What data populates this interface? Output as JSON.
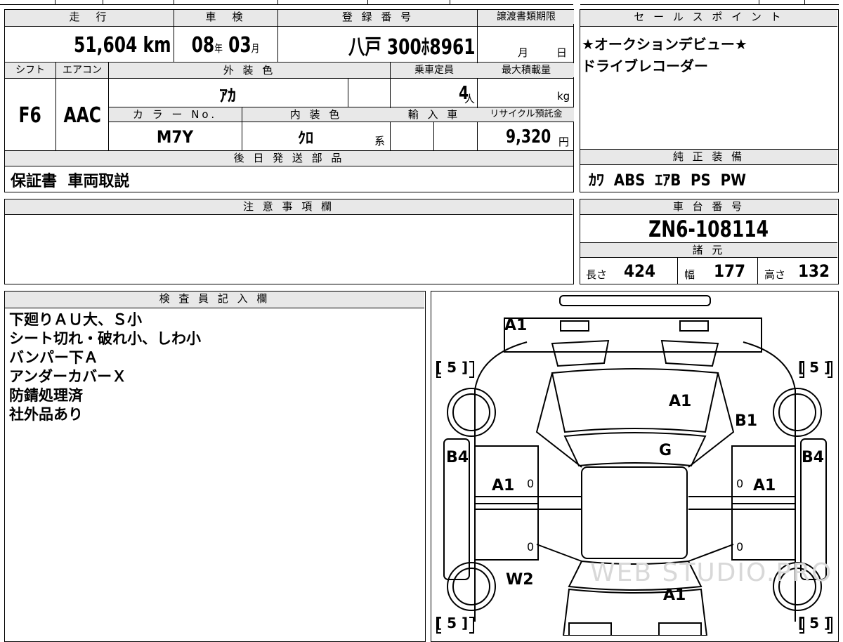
{
  "mileage": {
    "header": "走　行",
    "value": "51,604",
    "unit": "km"
  },
  "shaken": {
    "header": "車　検",
    "year": "08",
    "year_unit": "年",
    "month": "03",
    "month_unit": "月"
  },
  "registration": {
    "header": "登 録 番 号",
    "value": "八戸  300ﾎ8961"
  },
  "transfer_deadline": {
    "header": "譲渡書類期限",
    "month_unit": "月",
    "day_unit": "日"
  },
  "shift": {
    "header": "シフト",
    "value": "F6"
  },
  "aircon": {
    "header": "エアコン",
    "value": "AAC"
  },
  "exterior_color": {
    "header": "外 装 色",
    "value": "ｱｶ"
  },
  "capacity": {
    "header": "乗車定員",
    "value": "4",
    "unit": "人"
  },
  "max_load": {
    "header": "最大積載量",
    "unit": "kg"
  },
  "color_no": {
    "header": "カ ラ ー No.",
    "value": "M7Y"
  },
  "interior_color": {
    "header": "内 装 色",
    "value": "ｸﾛ",
    "unit": "系"
  },
  "import": {
    "header": "輸 入 車"
  },
  "recycle": {
    "header": "リサイクル預託金",
    "value": "9,320",
    "unit": "円"
  },
  "later_parts": {
    "header": "後 日 発 送 部 品",
    "value": "保証書  車両取説"
  },
  "sales_points": {
    "header": "セ ー ル ス ポ イ ン ト",
    "lines": [
      "★オークションデビュー★",
      "ドライブレコーダー"
    ]
  },
  "equipment": {
    "header": "純 正 装 備",
    "value": "ｶﾜ  ABS  ｴｱB  PS  PW"
  },
  "caution": {
    "header": "注 意 事 項 欄"
  },
  "chassis": {
    "header": "車 台 番 号",
    "value": "ZN6-108114"
  },
  "specs": {
    "header": "諸 元",
    "length_label": "長さ",
    "length": "424",
    "width_label": "幅",
    "width": "177",
    "height_label": "高さ",
    "height": "132"
  },
  "inspector": {
    "header": "検 査 員 記 入 欄",
    "lines": [
      "下廻りＡＵ大、Ｓ小",
      "シート切れ・破れ小、しわ小",
      "バンパー下Ａ",
      "アンダーカバーＸ",
      "防錆処理済",
      "社外品あり"
    ]
  },
  "diagram": {
    "marks": {
      "front_bumper": "A1",
      "hood": "A1",
      "roof_right": "B1",
      "windshield": "G",
      "left_pillar": "B4",
      "right_pillar": "B4",
      "left_door": "A1",
      "right_door": "A1",
      "left_rear": "W2",
      "trunk": "A1"
    },
    "tires": {
      "fl": "[ 5 ]",
      "fr": "[ 5 ]",
      "rl": "[ 5 ]",
      "rr": "[ 5 ]"
    },
    "zeros": {
      "a": "0",
      "b": "0",
      "c": "0",
      "d": "0"
    },
    "watermark": "WEB STUDIO.PRO"
  }
}
